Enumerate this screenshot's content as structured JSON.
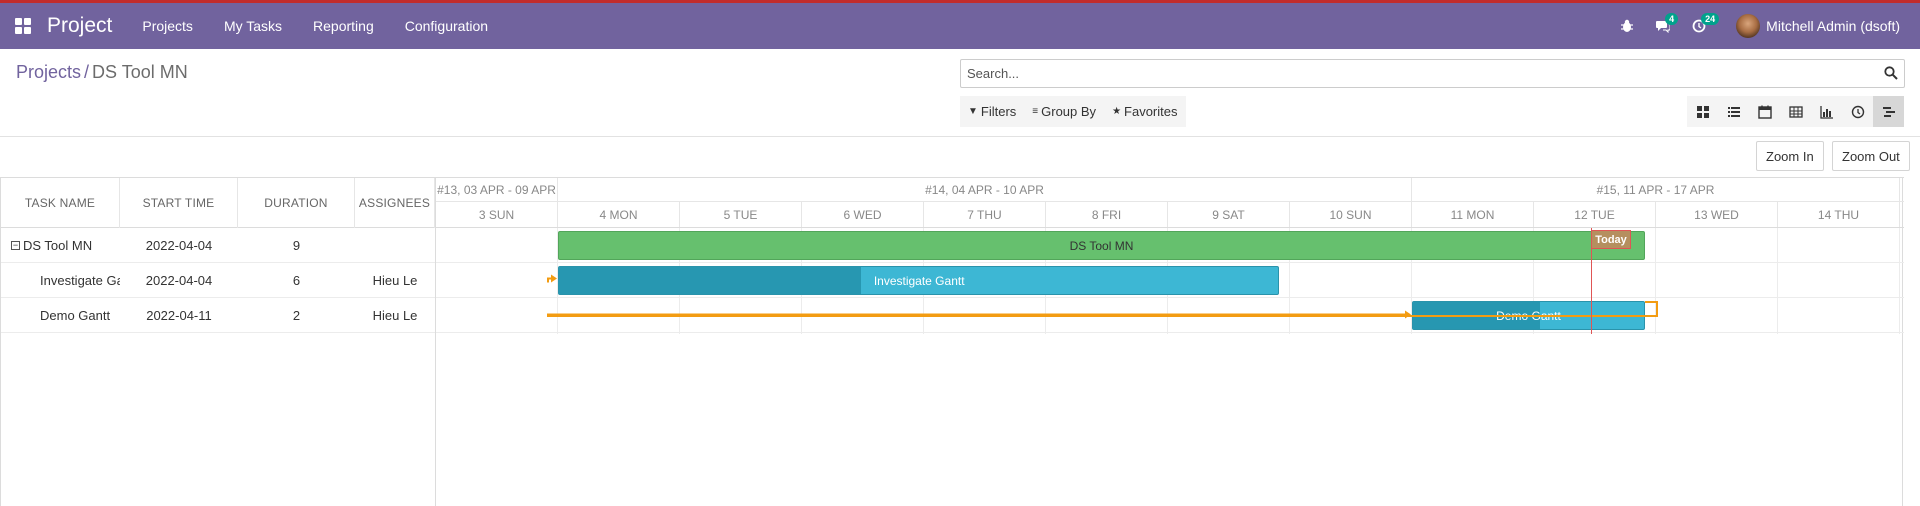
{
  "navbar": {
    "brand": "Project",
    "menu": [
      "Projects",
      "My Tasks",
      "Reporting",
      "Configuration"
    ],
    "messages_count": "4",
    "activities_count": "24",
    "user_name": "Mitchell Admin (dsoft)"
  },
  "breadcrumb": {
    "parent": "Projects",
    "separator": "/",
    "current": "DS Tool MN"
  },
  "search": {
    "placeholder": "Search..."
  },
  "filters": {
    "filters_label": "Filters",
    "groupby_label": "Group By",
    "favorites_label": "Favorites"
  },
  "views": [
    "kanban-icon",
    "list-icon",
    "calendar-icon",
    "pivot-icon",
    "graph-icon",
    "activity-icon",
    "gantt-icon"
  ],
  "active_view": "gantt",
  "toolbar": {
    "zoom_in": "Zoom In",
    "zoom_out": "Zoom Out"
  },
  "grid": {
    "columns": [
      "TASK NAME",
      "START TIME",
      "DURATION",
      "ASSIGNEES"
    ],
    "rows": [
      {
        "task": "DS Tool MN",
        "start": "2022-04-04",
        "duration": "9",
        "assignees": ""
      },
      {
        "task": "Investigate Gantt",
        "start": "2022-04-04",
        "duration": "6",
        "assignees": "Hieu Le"
      },
      {
        "task": "Demo Gantt",
        "start": "2022-04-11",
        "duration": "2",
        "assignees": "Hieu Le"
      }
    ]
  },
  "timeline": {
    "weeks": [
      "#13, 03 APR - 09 APR",
      "#14, 04 APR - 10 APR",
      "#15, 11 APR - 17 APR"
    ],
    "days": [
      "3 SUN",
      "4 MON",
      "5 TUE",
      "6 WED",
      "7 THU",
      "8 FRI",
      "9 SAT",
      "10 SUN",
      "11 MON",
      "12 TUE",
      "13 WED",
      "14 THU"
    ],
    "today_label": "Today",
    "today_date": "12 TUE",
    "bars": [
      {
        "label": "DS Tool MN",
        "type": "project",
        "start_day": "4 MON",
        "duration_days": 9,
        "progress": 0
      },
      {
        "label": "Investigate Gantt",
        "type": "task",
        "start_day": "4 MON",
        "duration_days": 6,
        "progress": 0.42
      },
      {
        "label": "Demo Gantt",
        "type": "task",
        "start_day": "11 MON",
        "duration_days": 2,
        "progress": 0.55
      }
    ]
  },
  "colors": {
    "navbar": "#71639e",
    "project_bar": "#66c06e",
    "task_bar": "#3db7d4",
    "task_progress": "#2797b1",
    "link": "#f39c12",
    "today": "#e05555"
  }
}
